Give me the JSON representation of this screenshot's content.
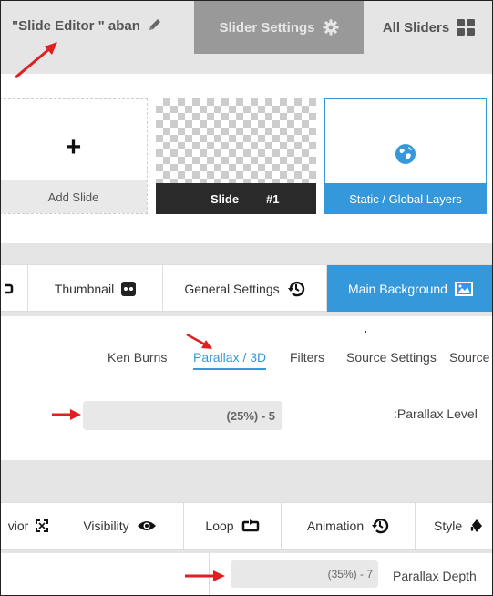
{
  "header": {
    "editor_title": "\"Slide Editor \" aban",
    "slider_settings": "Slider Settings",
    "all_sliders": "All Sliders"
  },
  "slides": {
    "add_slide": "Add Slide",
    "plus_symbol": "+",
    "slide_name": "Slide",
    "slide_number": "#1",
    "static_layers": "Static / Global Layers"
  },
  "main_tabs": [
    {
      "label": "Thumbnail"
    },
    {
      "label": "General Settings"
    },
    {
      "label": "Main Background"
    }
  ],
  "sub_tabs": [
    {
      "label": "Ken Burns"
    },
    {
      "label": "Parallax / 3D"
    },
    {
      "label": "Filters"
    },
    {
      "label": "Source Settings"
    },
    {
      "label": "Source"
    }
  ],
  "parallax_level": {
    "label": ":Parallax Level",
    "value": "(25%) - 5"
  },
  "layer_tabs": [
    {
      "label": "vior"
    },
    {
      "label": "Visibility"
    },
    {
      "label": "Loop"
    },
    {
      "label": "Animation"
    },
    {
      "label": "Style"
    }
  ],
  "parallax_depth": {
    "label": "Parallax Depth",
    "value": "(35%) - 7"
  },
  "colors": {
    "accent": "#3498db",
    "annotation_arrow": "#e02020",
    "header_active": "#999999"
  }
}
